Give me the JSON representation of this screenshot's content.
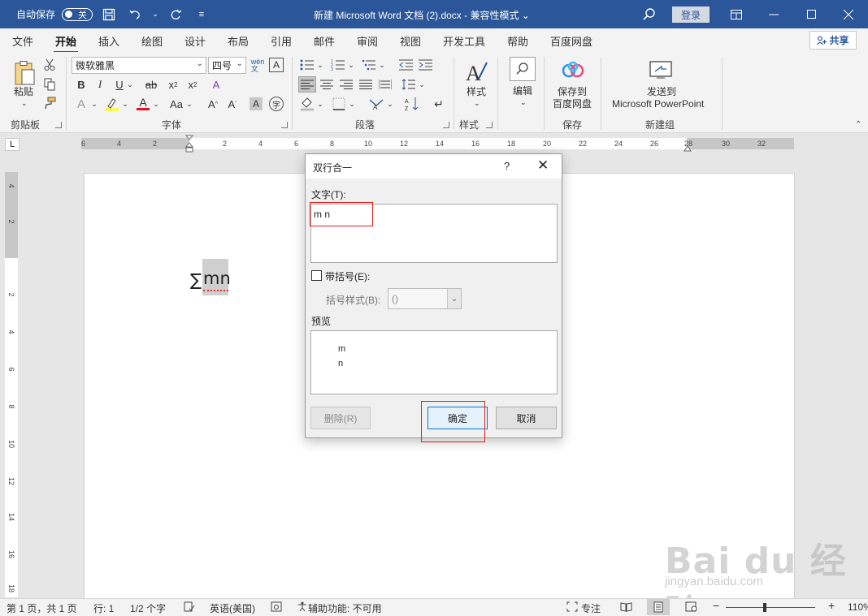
{
  "titlebar": {
    "autosave_label": "自动保存",
    "autosave_state": "关",
    "doc_title": "新建 Microsoft Word 文档 (2).docx  -  兼容性模式  ⌄",
    "login": "登录"
  },
  "tabs": [
    "文件",
    "开始",
    "插入",
    "绘图",
    "设计",
    "布局",
    "引用",
    "邮件",
    "审阅",
    "视图",
    "开发工具",
    "帮助",
    "百度网盘"
  ],
  "active_tab": "开始",
  "share_label": "共享",
  "ribbon": {
    "paste_label": "粘贴",
    "font_name": "微软雅黑",
    "font_size": "四号",
    "styles_label": "样式",
    "edit_label": "编辑",
    "save_baidu_line1": "保存到",
    "save_baidu_line2": "百度网盘",
    "send_ppt_line1": "发送到",
    "send_ppt_line2": "Microsoft PowerPoint",
    "groups": {
      "clipboard": "剪贴板",
      "font": "字体",
      "paragraph": "段落",
      "styles": "样式",
      "save": "保存",
      "newgroup": "新建组"
    }
  },
  "ruler": {
    "corner": "L",
    "h_ticks": [
      "6",
      "4",
      "2",
      "2",
      "4",
      "6",
      "8",
      "10",
      "12",
      "14",
      "16",
      "18",
      "20",
      "22",
      "24",
      "26",
      "28",
      "30",
      "32"
    ],
    "v_ticks": [
      "4",
      "2",
      "2",
      "4",
      "6",
      "8",
      "10",
      "12",
      "14",
      "16",
      "18"
    ]
  },
  "document": {
    "sigma": "∑",
    "selected_text": "mn"
  },
  "dialog": {
    "title": "双行合一",
    "help": "?",
    "close": "✕",
    "text_label": "文字(T):",
    "text_value": "m n",
    "bracket_label": "带括号(E):",
    "bracket_style_label": "括号样式(B):",
    "bracket_style_value": "()",
    "preview_label": "预览",
    "preview_line1": "m",
    "preview_line2": "n",
    "delete_button": "删除(R)",
    "ok_button": "确定",
    "cancel_button": "取消"
  },
  "statusbar": {
    "page": "第 1 页，共 1 页",
    "line": "行: 1",
    "words": "1/2 个字",
    "language": "英语(美国)",
    "accessibility": "辅助功能: 不可用",
    "focus": "专注",
    "zoom": "110%"
  },
  "watermark": {
    "main": "Bai du 经验",
    "sub": "jingyan.baidu.com"
  }
}
